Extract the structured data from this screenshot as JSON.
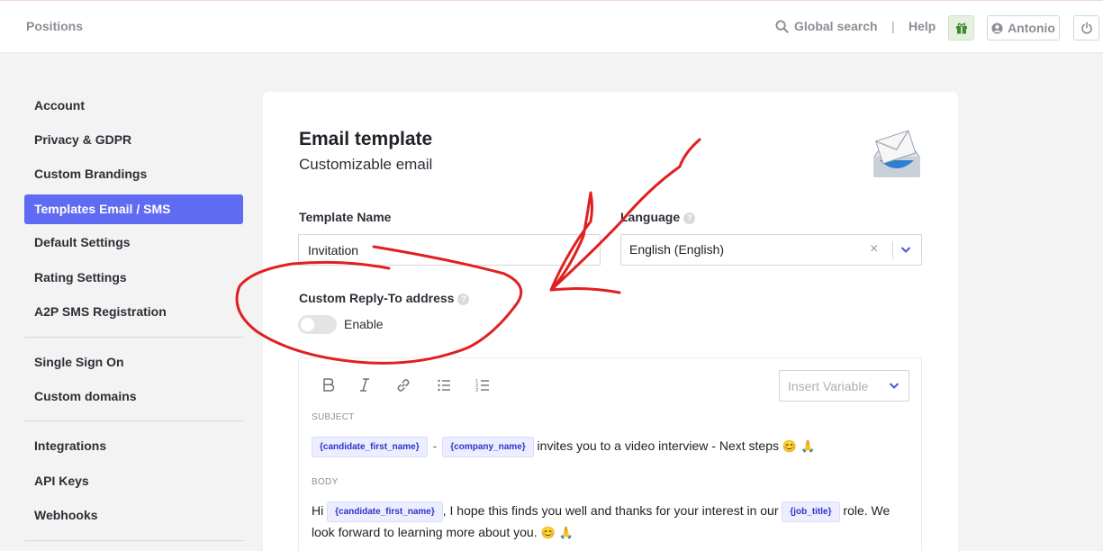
{
  "topbar": {
    "positions": "Positions",
    "global_search": "Global search",
    "separator": "|",
    "help": "Help",
    "user_name": "Antonio"
  },
  "sidebar": {
    "items": [
      {
        "label": "Account"
      },
      {
        "label": "Privacy & GDPR"
      },
      {
        "label": "Custom Brandings"
      },
      {
        "label": "Templates Email / SMS",
        "active": true
      },
      {
        "label": "Default Settings"
      },
      {
        "label": "Rating Settings"
      },
      {
        "label": "A2P SMS Registration"
      },
      {
        "label": "Single Sign On"
      },
      {
        "label": "Custom domains"
      },
      {
        "label": "Integrations"
      },
      {
        "label": "API Keys"
      },
      {
        "label": "Webhooks"
      }
    ]
  },
  "card": {
    "title": "Email template",
    "subtitle": "Customizable email",
    "template_name_label": "Template Name",
    "template_name_value": "Invitation",
    "language_label": "Language",
    "language_value": "English (English)",
    "reply_to_label": "Custom Reply-To address",
    "enable_label": "Enable",
    "reply_to_enabled": false
  },
  "editor": {
    "insert_variable_placeholder": "Insert Variable",
    "subject_label": "SUBJECT",
    "subject_var1": "{candidate_first_name}",
    "subject_dash": "-",
    "subject_var2": "{company_name}",
    "subject_text": "invites you to a video interview - Next steps",
    "body_label": "BODY",
    "body_hi": "Hi",
    "body_var1": "{candidate_first_name}",
    "body_text1": ",  I hope this finds you well and thanks for your interest in our",
    "body_var2": "{job_title}",
    "body_text2": "role. We",
    "body_line2": "look forward to learning more about you."
  },
  "colors": {
    "accent": "#5e6bf2",
    "annotation_red": "#e02020",
    "chip_text": "#2b35c9"
  }
}
